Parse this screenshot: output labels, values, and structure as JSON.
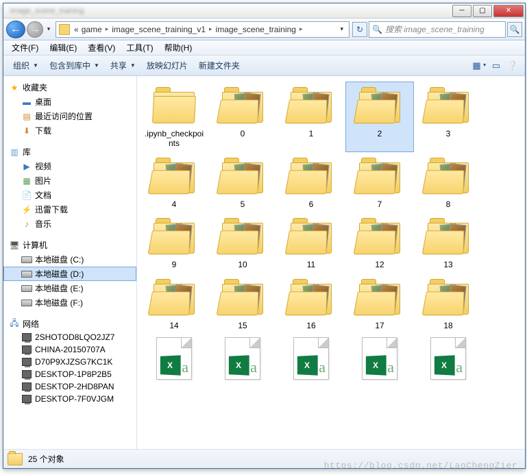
{
  "window": {
    "title": "image_scene_training"
  },
  "titlebar": {
    "min_tip": "最小化",
    "max_tip": "最大化",
    "close_tip": "关闭"
  },
  "nav": {
    "back_tip": "后退",
    "fwd_tip": "前进",
    "crumb0": "«",
    "crumb1": "game",
    "crumb2": "image_scene_training_v1",
    "crumb3": "image_scene_training",
    "refresh_tip": "刷新",
    "search_placeholder": "搜索 image_scene_training"
  },
  "menubar": {
    "file": "文件(F)",
    "edit": "编辑(E)",
    "view": "查看(V)",
    "tools": "工具(T)",
    "help": "帮助(H)"
  },
  "toolbar": {
    "organize": "组织",
    "include": "包含到库中",
    "share": "共享",
    "slideshow": "放映幻灯片",
    "newfolder": "新建文件夹"
  },
  "sidebar": {
    "favorites": {
      "label": "收藏夹",
      "items": [
        "桌面",
        "最近访问的位置",
        "下载"
      ]
    },
    "libraries": {
      "label": "库",
      "items": [
        "视频",
        "图片",
        "文档",
        "迅雷下载",
        "音乐"
      ]
    },
    "computer": {
      "label": "计算机",
      "items": [
        "本地磁盘 (C:)",
        "本地磁盘 (D:)",
        "本地磁盘 (E:)",
        "本地磁盘 (F:)"
      ]
    },
    "network": {
      "label": "网络",
      "items": [
        "2SHOTOD8LQO2JZ7",
        "CHINA-20150707A",
        "D70P9XJZSG7KC1K",
        "DESKTOP-1P8P2B5",
        "DESKTOP-2HD8PAN",
        "DESKTOP-7F0VJGM"
      ]
    }
  },
  "items": [
    {
      "name": ".ipynb_checkpoints",
      "type": "folder-plain"
    },
    {
      "name": "0",
      "type": "folder-thumb"
    },
    {
      "name": "1",
      "type": "folder-thumb"
    },
    {
      "name": "2",
      "type": "folder-thumb",
      "selected": true
    },
    {
      "name": "3",
      "type": "folder-thumb"
    },
    {
      "name": "4",
      "type": "folder-thumb"
    },
    {
      "name": "5",
      "type": "folder-thumb"
    },
    {
      "name": "6",
      "type": "folder-thumb"
    },
    {
      "name": "7",
      "type": "folder-thumb"
    },
    {
      "name": "8",
      "type": "folder-thumb"
    },
    {
      "name": "9",
      "type": "folder-thumb"
    },
    {
      "name": "10",
      "type": "folder-thumb"
    },
    {
      "name": "11",
      "type": "folder-thumb"
    },
    {
      "name": "12",
      "type": "folder-thumb"
    },
    {
      "name": "13",
      "type": "folder-thumb"
    },
    {
      "name": "14",
      "type": "folder-thumb"
    },
    {
      "name": "15",
      "type": "folder-thumb"
    },
    {
      "name": "16",
      "type": "folder-thumb"
    },
    {
      "name": "17",
      "type": "folder-thumb"
    },
    {
      "name": "18",
      "type": "folder-thumb"
    },
    {
      "name": "",
      "type": "excel"
    },
    {
      "name": "",
      "type": "excel"
    },
    {
      "name": "",
      "type": "excel"
    },
    {
      "name": "",
      "type": "excel"
    },
    {
      "name": "",
      "type": "excel"
    }
  ],
  "status": {
    "count": "25 个对象"
  },
  "watermark": "https://blog.csdn.net/LaoChengZier"
}
